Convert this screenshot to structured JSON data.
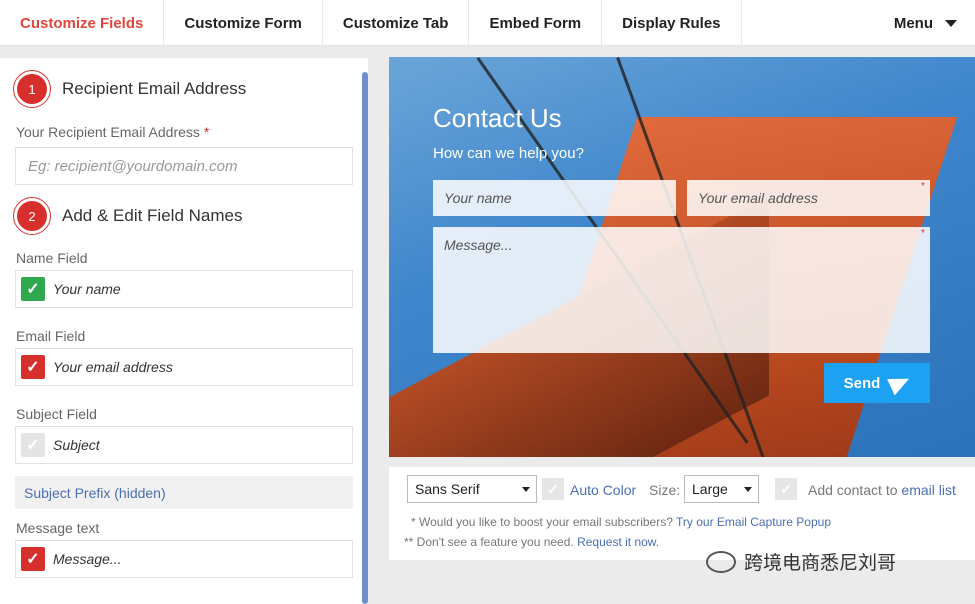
{
  "nav": {
    "tabs": [
      {
        "label": "Customize Fields"
      },
      {
        "label": "Customize Form"
      },
      {
        "label": "Customize Tab"
      },
      {
        "label": "Embed Form"
      },
      {
        "label": "Display Rules"
      }
    ],
    "menu_label": "Menu"
  },
  "left": {
    "step1": {
      "number": "1",
      "title": "Recipient Email Address"
    },
    "recipient_label": "Your Recipient Email Address",
    "required_mark": "*",
    "recipient_placeholder": "Eg: recipient@yourdomain.com",
    "step2": {
      "number": "2",
      "title": "Add & Edit Field Names"
    },
    "name_field": {
      "label": "Name Field",
      "value": "Your name",
      "check": "✓"
    },
    "email_field": {
      "label": "Email Field",
      "value": "Your email address",
      "check": "✓"
    },
    "subject_field": {
      "label": "Subject Field",
      "value": "Subject",
      "check": "✓"
    },
    "subject_prefix": "Subject Prefix (hidden)",
    "message_field": {
      "label": "Message text",
      "value": "Message...",
      "check": "✓"
    }
  },
  "preview": {
    "title": "Contact Us",
    "subtitle": "How can we help you?",
    "name_placeholder": "Your name",
    "email_placeholder": "Your email address",
    "message_placeholder": "Message...",
    "required_mark": "*",
    "send_label": "Send"
  },
  "options": {
    "font_value": "Sans Serif",
    "auto_color_label": "Auto Color",
    "size_label": "Size:",
    "size_value": "Large",
    "add_contact_prefix": "Add contact to ",
    "add_contact_link": "email list",
    "note1_prefix": "* Would you like to boost your email subscribers? ",
    "note1_link": "Try our Email Capture Popup",
    "note2_prefix": "** Don't see a feature you need. ",
    "note2_link": "Request it now."
  },
  "watermark": "跨境电商悉尼刘哥",
  "colors": {
    "accent": "#e0463d",
    "step_badge": "#d7302c",
    "link": "#4a6fb4",
    "send": "#1da1f2",
    "check_green": "#2fa84f"
  }
}
